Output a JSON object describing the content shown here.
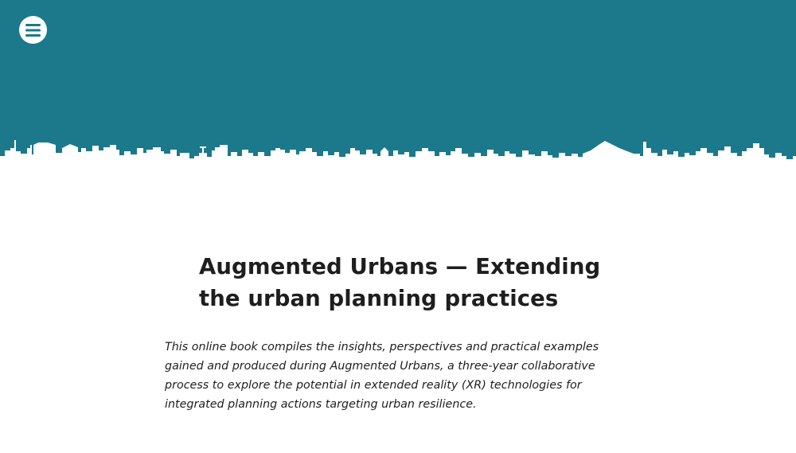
{
  "header": {
    "menu_icon": "hamburger-menu-icon",
    "background_color": "#1b798b",
    "skyline_color": "#ffffff"
  },
  "main": {
    "title_line1": "Augmented Urbans — Extending",
    "title_line2": "the urban planning practices",
    "intro_lines": [
      "This online book compiles the insights, perspectives and practical examples",
      "gained and produced during Augmented Urbans, a three-year collaborative",
      "process to explore the potential in extended reality (XR) technologies for",
      "integrated planning actions targeting urban resilience."
    ]
  }
}
